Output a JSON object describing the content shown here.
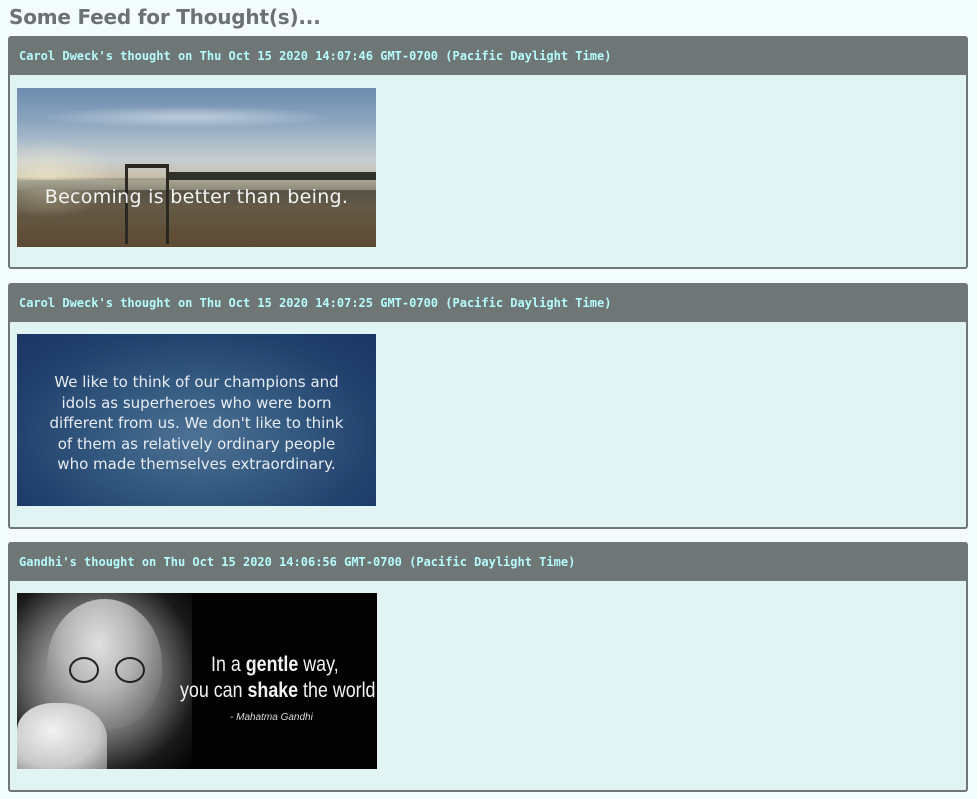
{
  "page": {
    "title": "Some Feed for Thought(s)..."
  },
  "feed": [
    {
      "header": "Carol Dweck's thought on Thu Oct 15 2020 14:07:46 GMT-0700 (Pacific Daylight Time)",
      "image_text": "Becoming is better than being."
    },
    {
      "header": "Carol Dweck's thought on Thu Oct 15 2020 14:07:25 GMT-0700 (Pacific Daylight Time)",
      "image_lines": [
        "We like to think of our champions and",
        "idols as superheroes who were born",
        "different from us. We don't like to think",
        "of them as relatively ordinary people",
        "who made themselves extraordinary."
      ]
    },
    {
      "header": "Gandhi's thought on Thu Oct 15 2020 14:06:56 GMT-0700 (Pacific Daylight Time)",
      "image_line1": {
        "a": "In a ",
        "b": "gentle",
        "c": " way,"
      },
      "image_line2": {
        "a": "you can ",
        "b": "shake",
        "c": " the world."
      },
      "attribution": "- Mahatma Gandhi"
    }
  ],
  "colors": {
    "header_bg": "#6e7676",
    "header_text": "#b6fbfb",
    "card_bg": "#e2f3f3",
    "page_bg": "#f3fcfc",
    "title_text": "#6a7272"
  }
}
